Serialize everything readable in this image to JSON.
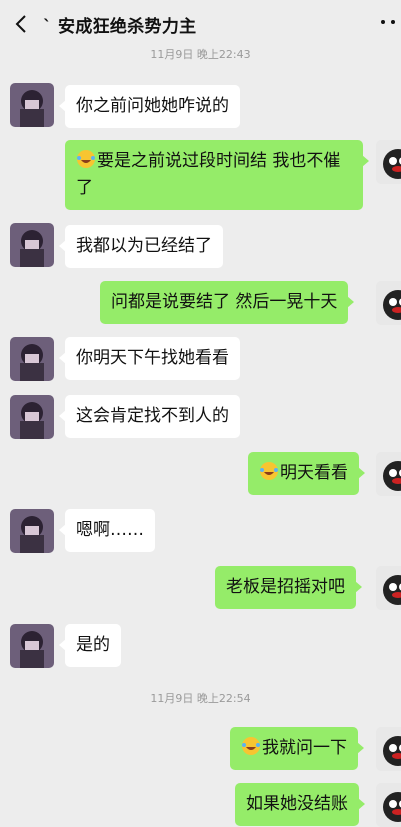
{
  "header": {
    "title": "ˋ 安成狂绝杀势力主",
    "back_icon": "chevron-left-icon",
    "more_icon": "more-dots-icon"
  },
  "timestamps": [
    "11月9日 晚上22:43",
    "11月9日 晚上22:54"
  ],
  "messages": [
    {
      "side": "left",
      "text": "你之前问她她咋说的"
    },
    {
      "side": "right",
      "emoji": "laugh-cry-emoji",
      "text": "要是之前说过段时间结  我也不催了"
    },
    {
      "side": "left",
      "text": "我都以为已经结了"
    },
    {
      "side": "right",
      "text": "问都是说要结了 然后一晃十天"
    },
    {
      "side": "left",
      "text": "你明天下午找她看看"
    },
    {
      "side": "left",
      "text": "这会肯定找不到人的"
    },
    {
      "side": "right",
      "emoji": "laugh-cry-emoji",
      "text": "明天看看"
    },
    {
      "side": "left",
      "text": "嗯啊……"
    },
    {
      "side": "right",
      "text": "老板是招摇对吧"
    },
    {
      "side": "left",
      "text": "是的"
    },
    {
      "side": "right",
      "emoji": "laugh-cry-emoji",
      "text": "我就问一下"
    },
    {
      "side": "right",
      "text": "如果她没结账"
    }
  ],
  "colors": {
    "background": "#ededed",
    "bubble_left": "#ffffff",
    "bubble_right": "#95ec69",
    "timestamp": "#9a9a9a"
  }
}
